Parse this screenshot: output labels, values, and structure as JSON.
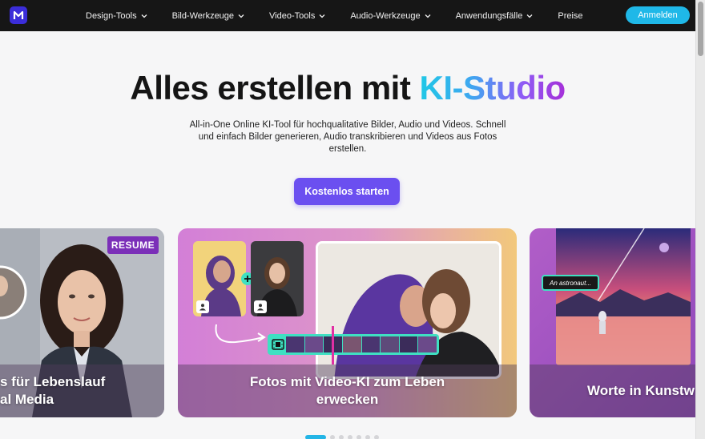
{
  "nav": {
    "items": [
      {
        "label": "Design-Tools",
        "has_dropdown": true
      },
      {
        "label": "Bild-Werkzeuge",
        "has_dropdown": true
      },
      {
        "label": "Video-Tools",
        "has_dropdown": true
      },
      {
        "label": "Audio-Werkzeuge",
        "has_dropdown": true
      },
      {
        "label": "Anwendungsfälle",
        "has_dropdown": true
      },
      {
        "label": "Preise",
        "has_dropdown": false
      }
    ],
    "login_label": "Anmelden"
  },
  "hero": {
    "title_plain": "Alles erstellen mit ",
    "title_highlight": "KI-Studio",
    "subtitle": "All-in-One Online KI-Tool für hochqualitative Bilder, Audio und Videos. Schnell und einfach Bilder generieren, Audio transkribieren und Videos aus Fotos erstellen.",
    "cta_label": "Kostenlos starten"
  },
  "cards": [
    {
      "title_line1": "s für Lebenslauf",
      "title_line2": "al Media",
      "badge": "RESUME"
    },
    {
      "title_line1": "Fotos mit Video-KI zum Leben",
      "title_line2": "erwecken"
    },
    {
      "title_line1": "Worte in Kunstw",
      "prompt_chip": "An astronaut..."
    }
  ],
  "carousel": {
    "total": 7,
    "active": 0
  },
  "colors": {
    "nav_bg": "#161616",
    "accent_cyan": "#1fb8e8",
    "accent_purple": "#6b4ff0",
    "gradient_start": "#20c8e6",
    "gradient_end": "#a52fd8"
  },
  "icons": [
    "logo-icon",
    "chevron-down-icon",
    "user-icon",
    "plus-icon",
    "film-icon",
    "arrow-icon"
  ]
}
